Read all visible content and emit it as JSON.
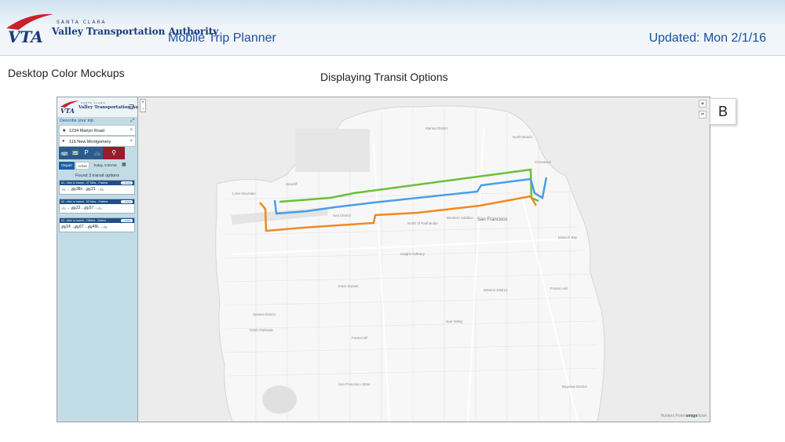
{
  "header": {
    "logo_small": "SANTA CLARA",
    "logo_name": "Valley Transportation Authority",
    "app_title": "Mobile Trip Planner",
    "updated": "Updated: Mon 2/1/16"
  },
  "labels": {
    "mockups": "Desktop Color Mockups",
    "transit": "Displaying Transit Options",
    "variant": "B"
  },
  "sidebar": {
    "logo_small": "SANTA CLARA",
    "logo_name": "Valley Transportation Authority",
    "describe": "Describe your trip",
    "from": "1234 Marlyn Road",
    "to": "116 New Montgomery",
    "depart": "Depart",
    "arrive": "Arrive",
    "datetime": "Today, 9:00AM",
    "found": "Found 3 transit options",
    "options": [
      {
        "title": "#1 - bike to transit - 47 Mins - Fastest",
        "details": "+ details",
        "legs": "🚲→ 🚌38x→🚌21→🚲"
      },
      {
        "title": "#2 - bike to transit - 59 Mins - Flattest",
        "details": "+ details",
        "legs": "🚲→ 🚌22→🚌57→🚲"
      },
      {
        "title": "#3 - bike to transit - 78Mins - Safest",
        "details": "+ details",
        "legs": "🚌14→🚌67→🚌49L→🚲"
      }
    ]
  },
  "map": {
    "attribution_left": "Hunters Point",
    "attribution_brand": "omigo",
    "attribution_brand2": "ticket",
    "places": [
      "Marina District",
      "North Beach",
      "Chinatown",
      "Seacliff",
      "Lone Mountain",
      "Sea District",
      "Inner Richmond",
      "North of Panhandle",
      "Western Addition",
      "San Francisco",
      "Haight-Ashbury",
      "Inner Sunset",
      "Outer Sunset",
      "Mission District",
      "Noe Valley",
      "Forest Hill",
      "Sunset District",
      "Outer Parkside",
      "Bayview District",
      "Mission Bay",
      "Potrero Hill",
      "Presidio Heights",
      "San Francisco State"
    ],
    "route_colors": {
      "route1": "#6bbf3a",
      "route2": "#4a9de8",
      "route3": "#ee8a22"
    }
  }
}
